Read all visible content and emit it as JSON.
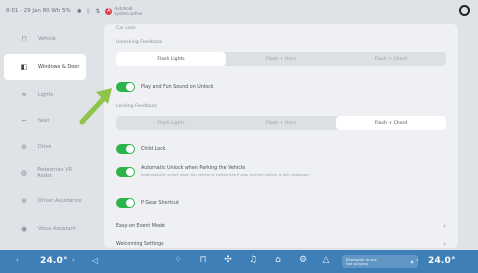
{
  "status_bar": {
    "time": "8:01 · 29 Jan  80  Wh  5%",
    "autohold_label_1": "Autohold",
    "autohold_label_2": "system active"
  },
  "sidebar": {
    "items": [
      {
        "label": "Vehicle",
        "icon": "car-icon"
      },
      {
        "label": "Windows & Door",
        "icon": "door-icon",
        "active": true
      },
      {
        "label": "Lights",
        "icon": "light-icon"
      },
      {
        "label": "Seat",
        "icon": "seat-icon"
      },
      {
        "label": "Drive",
        "icon": "steering-icon"
      },
      {
        "label": "Pedestrian VR Assist",
        "icon": "assist-icon"
      },
      {
        "label": "Driver Assistance",
        "icon": "shield-icon"
      },
      {
        "label": "Voice Assistant",
        "icon": "voice-icon"
      }
    ]
  },
  "main": {
    "top_label": "Car Lock",
    "unlocking_feedback": {
      "label": "Unlocking Feedback",
      "options": [
        "Flash Lights",
        "Flash + Horn",
        "Flash + Chord"
      ],
      "selected_index": 0
    },
    "play_fun_label": "Play and Fun Sound on Unlock",
    "locking_feedback": {
      "label": "Locking Feedback",
      "options": [
        "Flash Lights",
        "Flash + Horn",
        "Flash + Chord"
      ],
      "selected_index": 2
    },
    "child_lock_label": "Child Lock",
    "auto_unlock_label": "Automatic Unlock when Parking the Vehicle",
    "auto_unlock_sub": "Automatically unlock when the vehicle is shifted into P gear and the vehicle is fully stationary",
    "p_gear_label": "P Gear Shortcut",
    "easy_entry_label": "Easy-on Event Mode",
    "welcoming_label": "Welcoming Settings"
  },
  "bottom_bar": {
    "temp_left": "24.0°",
    "temp_right": "24.0°",
    "media_text_1": "Bluetooth music",
    "media_text_2": "Not playing"
  },
  "colors": {
    "accent_green": "#2db34a",
    "bottom_bar_blue": "#3f7fb8",
    "arrow_green": "#8fc34a"
  }
}
